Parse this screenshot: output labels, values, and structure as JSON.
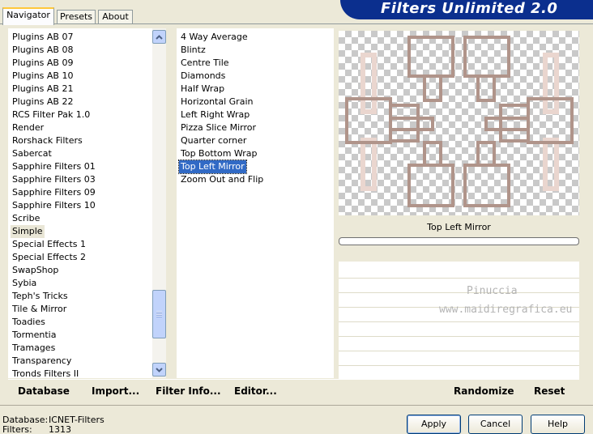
{
  "banner": {
    "title": "Filters Unlimited 2.0"
  },
  "tabs": [
    {
      "label": "Navigator"
    },
    {
      "label": "Presets"
    },
    {
      "label": "About"
    }
  ],
  "categories": [
    "Plugins AB 07",
    "Plugins AB 08",
    "Plugins AB 09",
    "Plugins AB 10",
    "Plugins AB 21",
    "Plugins AB 22",
    "RCS Filter Pak 1.0",
    "Render",
    "Rorshack Filters",
    "Sabercat",
    "Sapphire Filters 01",
    "Sapphire Filters 03",
    "Sapphire Filters 09",
    "Sapphire Filters 10",
    "Scribe",
    "Simple",
    "Special Effects 1",
    "Special Effects 2",
    "SwapShop",
    "Sybia",
    "Teph's Tricks",
    "Tile & Mirror",
    "Toadies",
    "Tormentia",
    "Tramages",
    "Transparency",
    "Tronds Filters II"
  ],
  "current_category": "Simple",
  "filters": [
    "4 Way Average",
    "Blintz",
    "Centre Tile",
    "Diamonds",
    "Half Wrap",
    "Horizontal Grain",
    "Left Right Wrap",
    "Pizza Slice Mirror",
    "Quarter corner",
    "Top Bottom Wrap",
    "Top Left Mirror",
    "Zoom Out and Flip"
  ],
  "selected_filter": "Top Left Mirror",
  "preview": {
    "filter_name": "Top Left Mirror",
    "progress": 0
  },
  "watermark": {
    "line1": "Pinuccia",
    "line2": "www.maidiregrafica.eu"
  },
  "toolbar": {
    "database": "Database",
    "import": "Import...",
    "filter_info": "Filter Info...",
    "editor": "Editor...",
    "randomize": "Randomize",
    "reset": "Reset"
  },
  "status": {
    "database_label": "Database:",
    "database_value": "ICNET-Filters",
    "filters_label": "Filters:",
    "filters_value": "1313"
  },
  "buttons": {
    "apply": "Apply",
    "cancel": "Cancel",
    "help": "Help"
  },
  "colors": {
    "banner": "#0b2f8e",
    "selection": "#316ac5",
    "preview_frame": "#b0948a"
  }
}
